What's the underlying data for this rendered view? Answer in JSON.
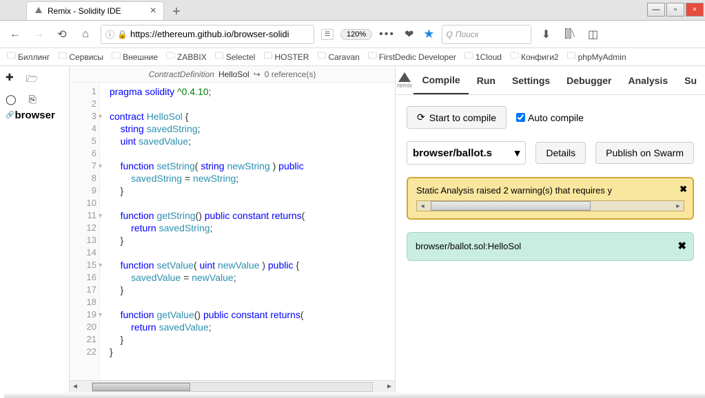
{
  "window": {
    "minimize": "—",
    "maximize": "▫",
    "close": "×"
  },
  "tab": {
    "title": "Remix - Solidity IDE"
  },
  "nav": {
    "url": "https://ethereum.github.io/browser-solidi",
    "zoom": "120%",
    "search_placeholder": "Поиск"
  },
  "bookmarks": [
    "Биллинг",
    "Сервисы",
    "Внешние",
    "ZABBIX",
    "Selectel",
    "HOSTER",
    "Caravan",
    "FirstDedic Developer",
    "1Cloud",
    "Конфиги2",
    "phpMyAdmin"
  ],
  "filepanel": {
    "browser": "browser"
  },
  "editor_header": {
    "defn": "ContractDefinition",
    "name": "HelloSol",
    "refs": "0 reference(s)"
  },
  "code": {
    "lines": [
      "pragma solidity ^0.4.10;",
      "",
      "contract HelloSol {",
      "    string savedString;",
      "    uint savedValue;",
      "",
      "    function setString( string newString ) public",
      "        savedString = newString;",
      "    }",
      "",
      "    function getString() public constant returns(",
      "        return savedString;",
      "    }",
      "",
      "    function setValue( uint newValue ) public {",
      "        savedValue = newValue;",
      "    }",
      "",
      "    function getValue() public constant returns(",
      "        return savedValue;",
      "    }",
      "}"
    ]
  },
  "remix": {
    "logo_text": "remix",
    "tabs": [
      "Compile",
      "Run",
      "Settings",
      "Debugger",
      "Analysis",
      "Su"
    ],
    "active_tab": 0,
    "start_compile": "Start to compile",
    "auto_compile": "Auto compile",
    "file_select": "browser/ballot.s",
    "details": "Details",
    "publish": "Publish on Swarm",
    "warning": "Static Analysis raised 2 warning(s) that requires y",
    "success": "browser/ballot.sol:HelloSol"
  }
}
